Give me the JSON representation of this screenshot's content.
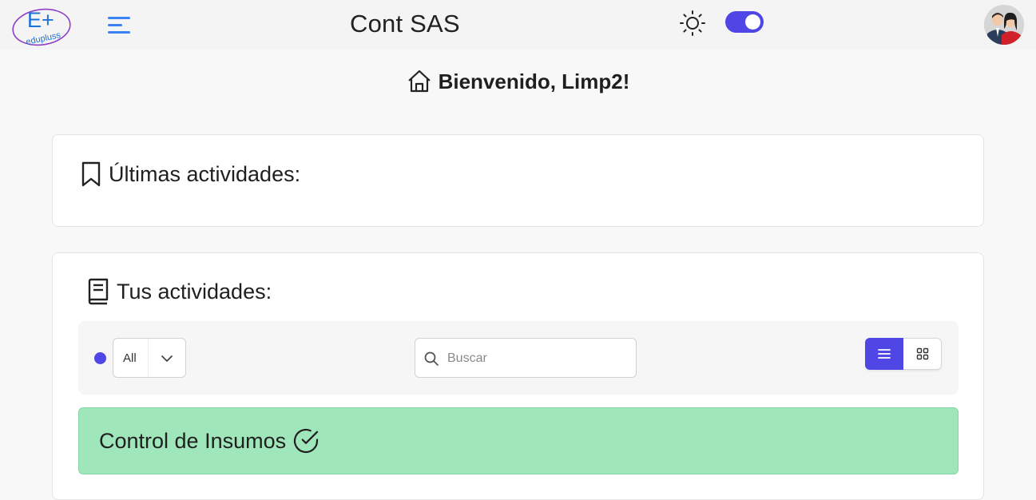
{
  "header": {
    "logo_text": "E+",
    "logo_subtext": "edupluss",
    "title": "Cont SAS",
    "theme_toggle_on": true
  },
  "welcome": {
    "text": "Bienvenido, Limp2!"
  },
  "recent": {
    "title": "Últimas actividades:"
  },
  "activities": {
    "title": "Tus actividades:",
    "filter": {
      "selected": "All"
    },
    "search": {
      "placeholder": "Buscar",
      "value": ""
    },
    "view_mode": "list",
    "items": [
      {
        "name": "Control de Insumos",
        "status": "completed"
      }
    ]
  },
  "colors": {
    "accent": "#4f46e5",
    "activity_bg": "#a0e6bb"
  }
}
